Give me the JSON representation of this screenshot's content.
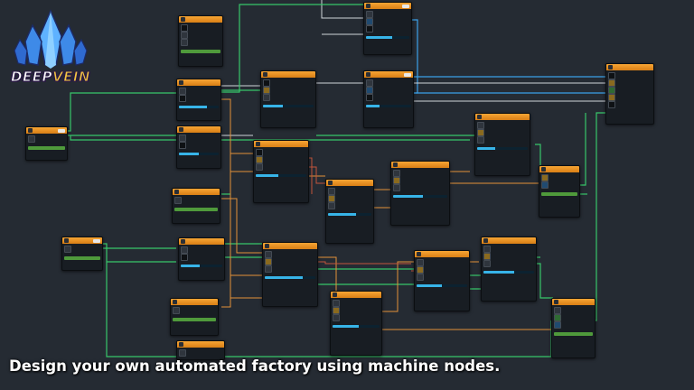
{
  "game": {
    "logo_text_main": "DEEP",
    "logo_text_accent": "VEIN"
  },
  "caption": "Design your own automated factory using machine nodes.",
  "colors": {
    "background": "#252b33",
    "node_header": "#f0952a",
    "node_body": "#181d23",
    "wire_green": "#38c66a",
    "wire_orange": "#e2913a",
    "wire_red": "#c4553c",
    "wire_blue": "#3ba0e8",
    "wire_white": "#d9dde3",
    "progress": "#37b4e8"
  },
  "icons": [
    "crystal-logo-icon",
    "machine-icon",
    "ore-icon",
    "gear-icon"
  ]
}
